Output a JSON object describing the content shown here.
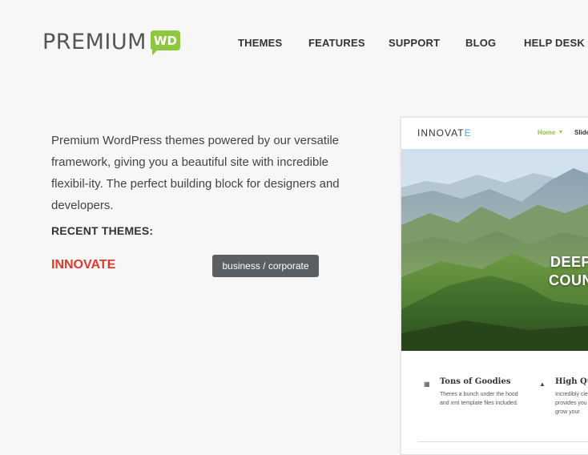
{
  "header": {
    "logo_text": "PREMIUM",
    "logo_badge": "WD",
    "nav": [
      {
        "label": "THEMES"
      },
      {
        "label": "FEATURES"
      },
      {
        "label": "SUPPORT"
      },
      {
        "label": "BLOG"
      },
      {
        "label": "HELP DESK"
      }
    ]
  },
  "intro": {
    "text": "Premium WordPress themes powered by our versatile framework, giving you a beautiful site with incredible flexibil-ity. The perfect building block for designers and developers."
  },
  "recent": {
    "title": "RECENT THEMES:",
    "themes": [
      {
        "name": "INNOVATE",
        "category": "business / corporate"
      }
    ]
  },
  "preview": {
    "logo_main": "INNOVAT",
    "logo_accent": "E",
    "nav_home": "Home",
    "nav_next": "Slide",
    "hero_line1": "DEEP",
    "hero_line2": "COUN",
    "features": [
      {
        "title": "Tons of Goodies",
        "desc": "Theres a bunch under the hood and xml template files included.",
        "icon": "grid-icon"
      },
      {
        "title": "High Qua",
        "desc": "Incredibly cle provides you to grow your",
        "icon": "flame-icon"
      }
    ]
  },
  "colors": {
    "background": "#f7f7f7",
    "logo_badge": "#8dc63f",
    "theme_link": "#e03a2f",
    "category_tag": "#5a5f64",
    "preview_accent": "#3fa9f5"
  }
}
